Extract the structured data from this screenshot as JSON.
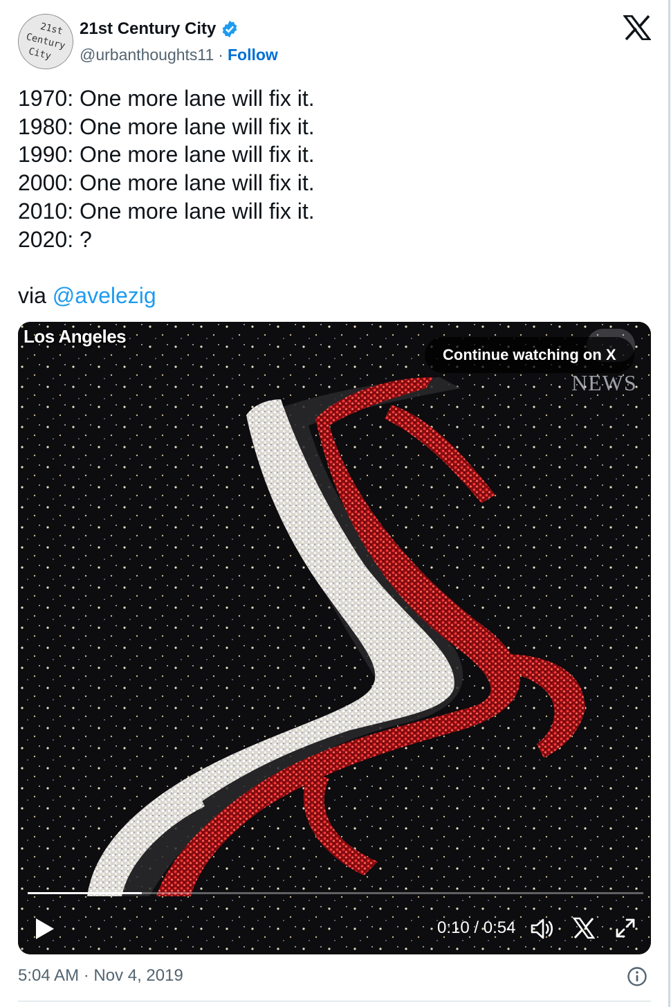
{
  "author": {
    "name": "21st Century City",
    "handle": "@urbanthoughts11",
    "separator": "·",
    "follow_label": "Follow",
    "avatar_text": [
      "21st",
      "Century",
      "City"
    ]
  },
  "tweet": {
    "lines": [
      "1970: One more lane will fix it.",
      "1980: One more lane will fix it.",
      "1990: One more lane will fix it.",
      "2000: One more lane will fix it.",
      "2010: One more lane will fix it.",
      "2020: ?"
    ],
    "via_prefix": "via ",
    "mention": "@avelezig"
  },
  "video": {
    "location_label": "Los Angeles",
    "watermark": "NEWS",
    "continue_label": "Continue watching on X",
    "time": "0:10 / 0:54",
    "progress_fraction": 0.185
  },
  "footer": {
    "timestamp": "5:04 AM · Nov 4, 2019"
  },
  "colors": {
    "verified": "#1d9bf0",
    "link": "#1d9bf0",
    "follow": "#006fd6",
    "secondary_text": "#536471"
  },
  "icons": {
    "close": "x-logo-icon",
    "verified": "verified-badge-icon",
    "play": "play-icon",
    "volume": "volume-icon",
    "fullscreen": "fullscreen-icon",
    "info": "info-icon"
  }
}
